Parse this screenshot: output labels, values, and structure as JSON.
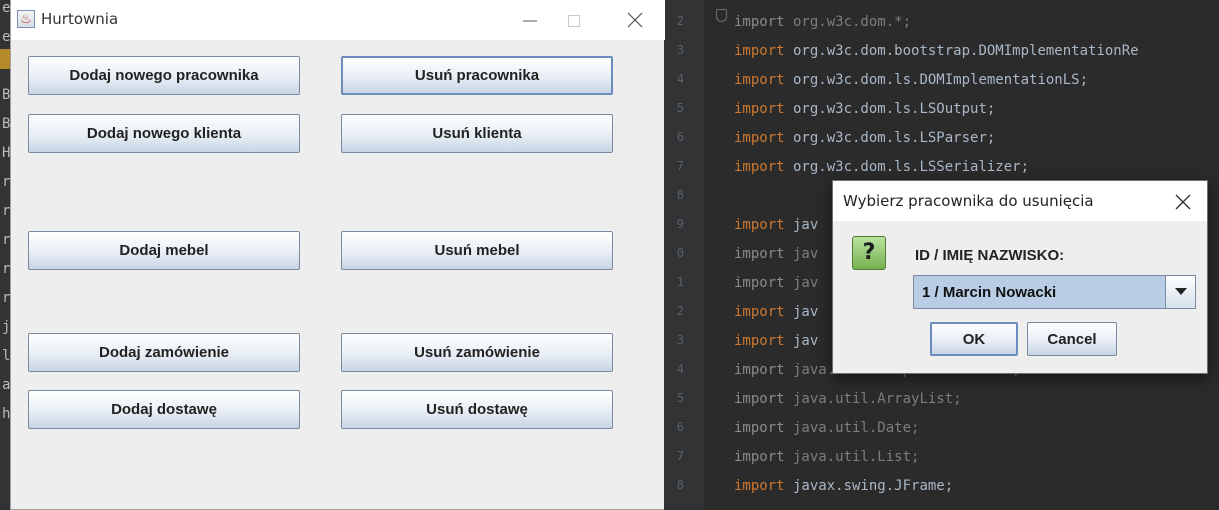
{
  "ide": {
    "left_fragments": [
      "e",
      "ea",
      "",
      "B",
      "B",
      "H",
      "rt",
      "rt",
      "rt",
      "rt",
      "rt",
      "je",
      "l.c",
      "al",
      "he"
    ],
    "line_numbers": [
      "2",
      "3",
      "4",
      "5",
      "6",
      "7",
      "8",
      "9",
      "0",
      "1",
      "2",
      "3",
      "4",
      "5",
      "6",
      "7",
      "8"
    ],
    "code_lines": [
      {
        "kw": "import",
        "rest": " org.w3c.dom.*;",
        "dim": true
      },
      {
        "kw": "import",
        "rest": " org.w3c.dom.bootstrap.DOMImplementationRe",
        "dim": false
      },
      {
        "kw": "import",
        "rest": " org.w3c.dom.ls.DOMImplementationLS;",
        "dim": false
      },
      {
        "kw": "import",
        "rest": " org.w3c.dom.ls.LSOutput;",
        "dim": false
      },
      {
        "kw": "import",
        "rest": " org.w3c.dom.ls.LSParser;",
        "dim": false
      },
      {
        "kw": "import",
        "rest": " org.w3c.dom.ls.LSSerializer;",
        "dim": false
      },
      {
        "kw": "",
        "rest": "",
        "dim": false
      },
      {
        "kw": "import",
        "rest": " jav",
        "dim": false
      },
      {
        "kw": "import",
        "rest": " jav",
        "dim": true
      },
      {
        "kw": "import",
        "rest": " jav",
        "dim": true
      },
      {
        "kw": "import",
        "rest": " jav",
        "dim": false
      },
      {
        "kw": "import",
        "rest": " jav",
        "dim": false
      },
      {
        "kw": "import",
        "rest": " java.text.SimpleDateFormat;",
        "dim": true
      },
      {
        "kw": "import",
        "rest": " java.util.ArrayList;",
        "dim": true
      },
      {
        "kw": "import",
        "rest": " java.util.Date;",
        "dim": true
      },
      {
        "kw": "import",
        "rest": " java.util.List;",
        "dim": true
      },
      {
        "kw": "import",
        "rest": " javax.swing.JFrame;",
        "dim": false
      }
    ]
  },
  "window": {
    "title": "Hurtownia",
    "controls": [
      "minimize-icon",
      "maximize-icon",
      "close-icon"
    ],
    "buttons": {
      "add_employee": "Dodaj nowego pracownika",
      "remove_employee": "Usuń pracownika",
      "add_client": "Dodaj nowego klienta",
      "remove_client": "Usuń klienta",
      "add_furniture": "Dodaj mebel",
      "remove_furniture": "Usuń mebel",
      "add_order": "Dodaj zamówienie",
      "remove_order": "Usuń zamówienie",
      "add_delivery": "Dodaj dostawę",
      "remove_delivery": "Usuń dostawę"
    }
  },
  "dialog": {
    "title": "Wybierz pracownika do usunięcia",
    "icon": "question-icon",
    "icon_glyph": "?",
    "message": "ID / IMIĘ NAZWISKO:",
    "selected": "1 / Marcin Nowacki",
    "ok_label": "OK",
    "cancel_label": "Cancel"
  },
  "colors": {
    "keyword": "#cc7832",
    "identifier": "#a9b7c6",
    "editor_bg": "#2b2b2b",
    "combo_selected_bg": "#b9cde5",
    "question_icon": "#76b150"
  }
}
